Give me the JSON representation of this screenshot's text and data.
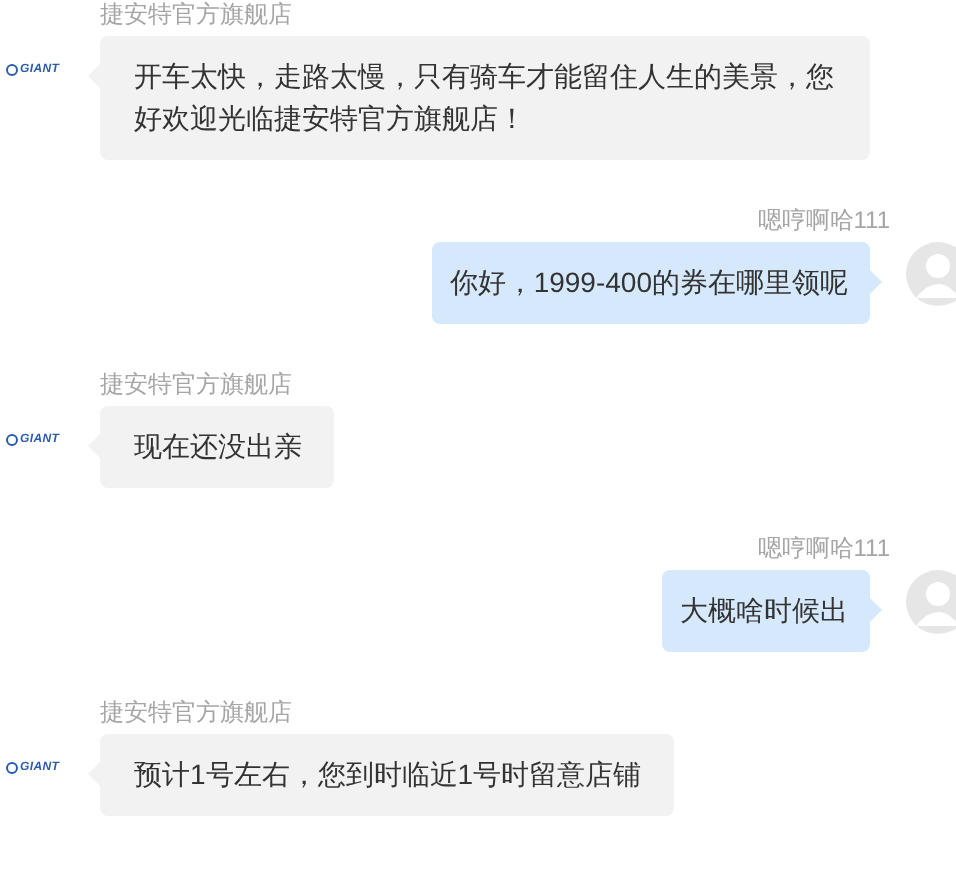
{
  "messages": [
    {
      "kind": "received",
      "sender": "捷安特官方旗舰店",
      "logo": "GIANT",
      "text": "开车太快，走路太慢，只有骑车才能留住人生的美景，您好欢迎光临捷安特官方旗舰店！"
    },
    {
      "kind": "sent",
      "sender": "嗯哼啊哈111",
      "text": "你好，1999-400的券在哪里领呢"
    },
    {
      "kind": "received",
      "sender": "捷安特官方旗舰店",
      "logo": "GIANT",
      "text": "现在还没出亲"
    },
    {
      "kind": "sent",
      "sender": "嗯哼啊哈111",
      "text": "大概啥时候出"
    },
    {
      "kind": "received",
      "sender": "捷安特官方旗舰店",
      "logo": "GIANT",
      "text": "预计1号左右，您到时临近1号时留意店铺"
    }
  ]
}
